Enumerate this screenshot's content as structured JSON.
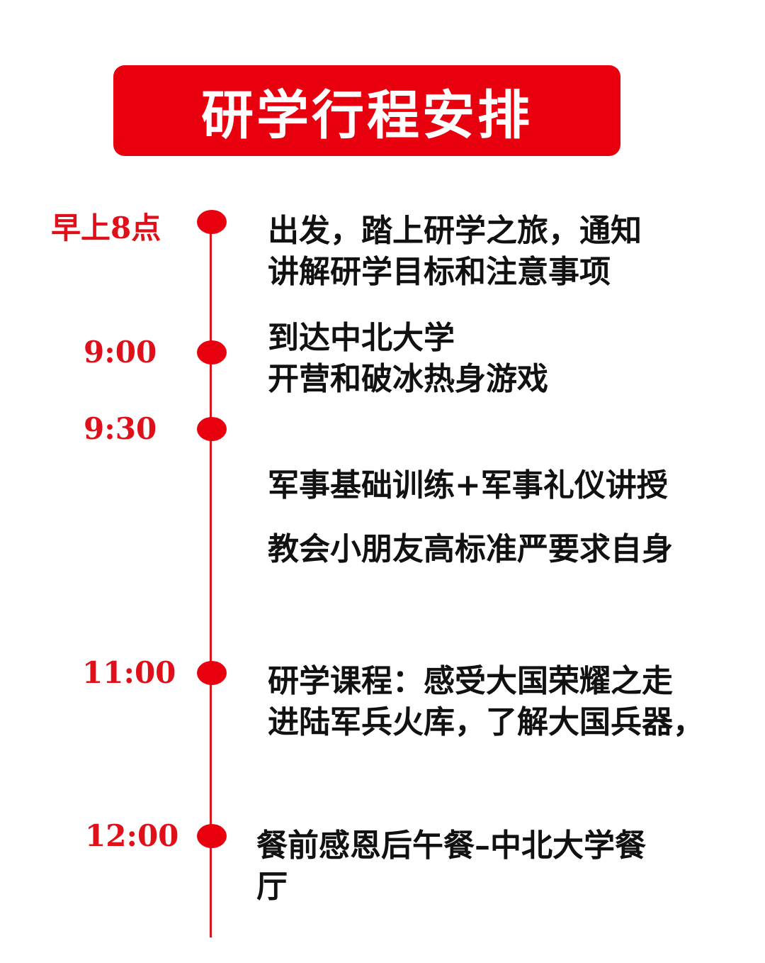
{
  "title": "研学行程安排",
  "colors": {
    "accent": "#e8000f",
    "text": "#111111",
    "time": "#e0101a"
  },
  "schedule": [
    {
      "time": "早上8点",
      "lines": [
        "出发，踏上研学之旅，通知",
        "讲解研学目标和注意事项"
      ]
    },
    {
      "time": "9:00",
      "lines": [
        "到达中北大学",
        "开营和破冰热身游戏"
      ]
    },
    {
      "time": "9:30",
      "lines": [
        "军事基础训练+军事礼仪讲授",
        "教会小朋友高标准严要求自身"
      ]
    },
    {
      "time": "11:00",
      "lines": [
        "研学课程：感受大国荣耀之走",
        "进陆军兵火库，了解大国兵器，"
      ]
    },
    {
      "time": "12:00",
      "lines": [
        "餐前感恩后午餐–中北大学餐",
        "厅"
      ]
    }
  ]
}
